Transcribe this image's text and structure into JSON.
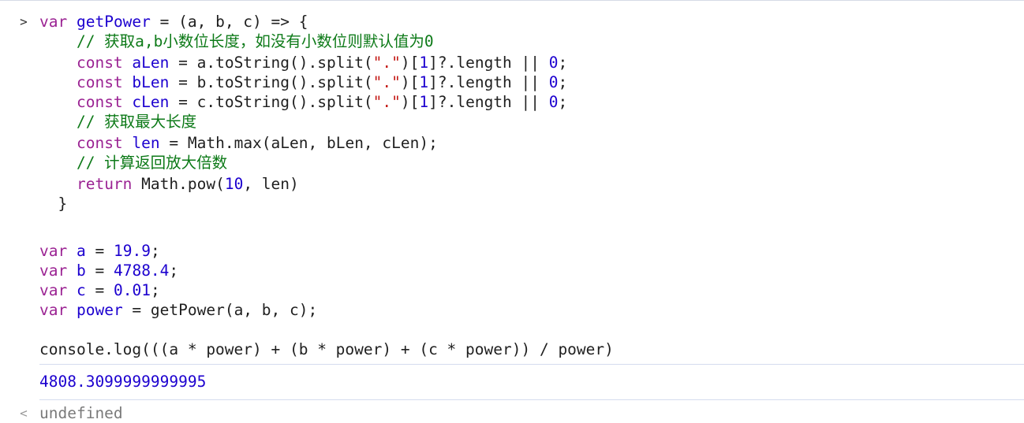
{
  "console": {
    "input_prompt_glyph": ">",
    "output_prompt_glyph": "<",
    "function_block": [
      [
        {
          "t": "var",
          "c": "kw"
        },
        {
          "t": " ",
          "c": "plain"
        },
        {
          "t": "getPower",
          "c": "id"
        },
        {
          "t": " = (a, b, c) => {",
          "c": "plain"
        }
      ],
      [
        {
          "t": "    // 获取a,b小数位长度，如没有小数位则默认值为0",
          "c": "cm"
        }
      ],
      [
        {
          "t": "    ",
          "c": "plain"
        },
        {
          "t": "const",
          "c": "kw"
        },
        {
          "t": " ",
          "c": "plain"
        },
        {
          "t": "aLen",
          "c": "id"
        },
        {
          "t": " = a.toString().split(",
          "c": "plain"
        },
        {
          "t": "\".\"",
          "c": "str"
        },
        {
          "t": ")[",
          "c": "plain"
        },
        {
          "t": "1",
          "c": "num"
        },
        {
          "t": "]?.length || ",
          "c": "plain"
        },
        {
          "t": "0",
          "c": "num"
        },
        {
          "t": ";",
          "c": "plain"
        }
      ],
      [
        {
          "t": "    ",
          "c": "plain"
        },
        {
          "t": "const",
          "c": "kw"
        },
        {
          "t": " ",
          "c": "plain"
        },
        {
          "t": "bLen",
          "c": "id"
        },
        {
          "t": " = b.toString().split(",
          "c": "plain"
        },
        {
          "t": "\".\"",
          "c": "str"
        },
        {
          "t": ")[",
          "c": "plain"
        },
        {
          "t": "1",
          "c": "num"
        },
        {
          "t": "]?.length || ",
          "c": "plain"
        },
        {
          "t": "0",
          "c": "num"
        },
        {
          "t": ";",
          "c": "plain"
        }
      ],
      [
        {
          "t": "    ",
          "c": "plain"
        },
        {
          "t": "const",
          "c": "kw"
        },
        {
          "t": " ",
          "c": "plain"
        },
        {
          "t": "cLen",
          "c": "id"
        },
        {
          "t": " = c.toString().split(",
          "c": "plain"
        },
        {
          "t": "\".\"",
          "c": "str"
        },
        {
          "t": ")[",
          "c": "plain"
        },
        {
          "t": "1",
          "c": "num"
        },
        {
          "t": "]?.length || ",
          "c": "plain"
        },
        {
          "t": "0",
          "c": "num"
        },
        {
          "t": ";",
          "c": "plain"
        }
      ],
      [
        {
          "t": "    // 获取最大长度",
          "c": "cm"
        }
      ],
      [
        {
          "t": "    ",
          "c": "plain"
        },
        {
          "t": "const",
          "c": "kw"
        },
        {
          "t": " ",
          "c": "plain"
        },
        {
          "t": "len",
          "c": "id"
        },
        {
          "t": " = Math.max(aLen, bLen, cLen);",
          "c": "plain"
        }
      ],
      [
        {
          "t": "    // 计算返回放大倍数",
          "c": "cm"
        }
      ],
      [
        {
          "t": "    ",
          "c": "plain"
        },
        {
          "t": "return",
          "c": "kw"
        },
        {
          "t": " Math.pow(",
          "c": "plain"
        },
        {
          "t": "10",
          "c": "num"
        },
        {
          "t": ", len)",
          "c": "plain"
        }
      ],
      [
        {
          "t": "  }",
          "c": "plain"
        }
      ]
    ],
    "var_block": [
      [
        {
          "t": "var",
          "c": "kw"
        },
        {
          "t": " ",
          "c": "plain"
        },
        {
          "t": "a",
          "c": "id"
        },
        {
          "t": " = ",
          "c": "plain"
        },
        {
          "t": "19.9",
          "c": "num"
        },
        {
          "t": ";",
          "c": "plain"
        }
      ],
      [
        {
          "t": "var",
          "c": "kw"
        },
        {
          "t": " ",
          "c": "plain"
        },
        {
          "t": "b",
          "c": "id"
        },
        {
          "t": " = ",
          "c": "plain"
        },
        {
          "t": "4788.4",
          "c": "num"
        },
        {
          "t": ";",
          "c": "plain"
        }
      ],
      [
        {
          "t": "var",
          "c": "kw"
        },
        {
          "t": " ",
          "c": "plain"
        },
        {
          "t": "c",
          "c": "id"
        },
        {
          "t": " = ",
          "c": "plain"
        },
        {
          "t": "0.01",
          "c": "num"
        },
        {
          "t": ";",
          "c": "plain"
        }
      ],
      [
        {
          "t": "var",
          "c": "kw"
        },
        {
          "t": " ",
          "c": "plain"
        },
        {
          "t": "power",
          "c": "id"
        },
        {
          "t": " = getPower(a, b, c);",
          "c": "plain"
        }
      ]
    ],
    "log_line": "console.log(((a * power) + (b * power) + (c * power)) / power)",
    "log_output": "4808.3099999999995",
    "return_value": "undefined"
  }
}
